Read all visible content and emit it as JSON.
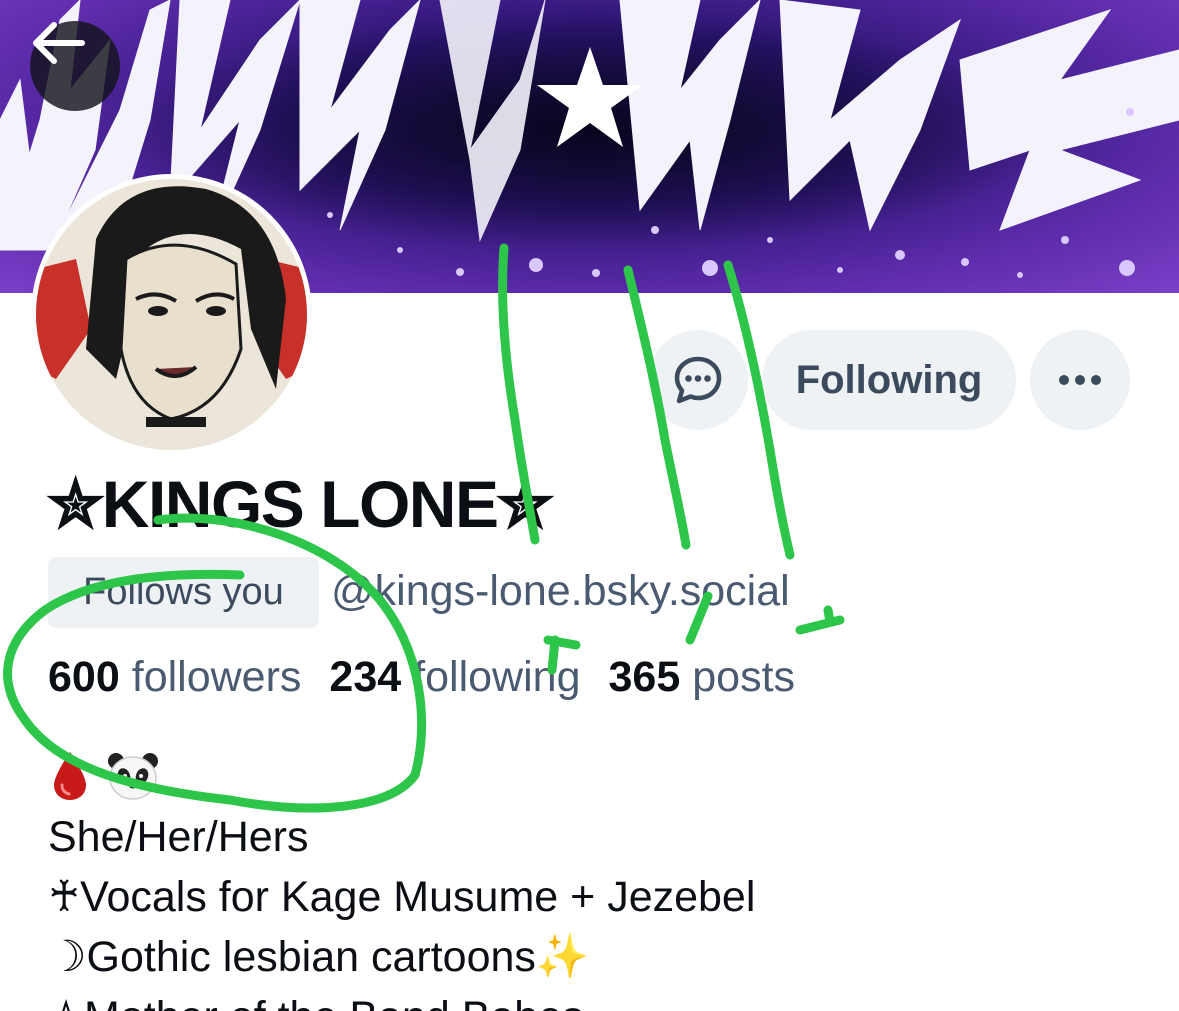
{
  "header": {
    "back_icon": "arrow-left-icon"
  },
  "profile": {
    "display_name": "✮KINGS LONE✮",
    "follows_you": "Follows you",
    "handle": "@kings-lone.bsky.social",
    "stats": {
      "followers_count": "600",
      "followers_label": "followers",
      "following_count": "234",
      "following_label": "following",
      "posts_count": "365",
      "posts_label": "posts"
    },
    "bio": {
      "emojis": [
        "drop-of-blood-icon",
        "panda-face-icon"
      ],
      "pronouns": "She/Her/Hers",
      "line_vocals": "♰Vocals for Kage Musume + Jezebel",
      "line_cartoons": "☽Gothic lesbian cartoons",
      "line_cartoons_emoji": "✨",
      "line_partial": "✮Mother of the Band Babes"
    }
  },
  "actions": {
    "message_icon": "chat-bubble-icon",
    "following_label": "Following",
    "more_icon": "ellipsis-icon"
  },
  "colors": {
    "button_bg": "#eef2f5",
    "muted_text": "#4a5a70",
    "banner_purple": "#7b3fc8",
    "annotation_green": "#2ec64a"
  }
}
